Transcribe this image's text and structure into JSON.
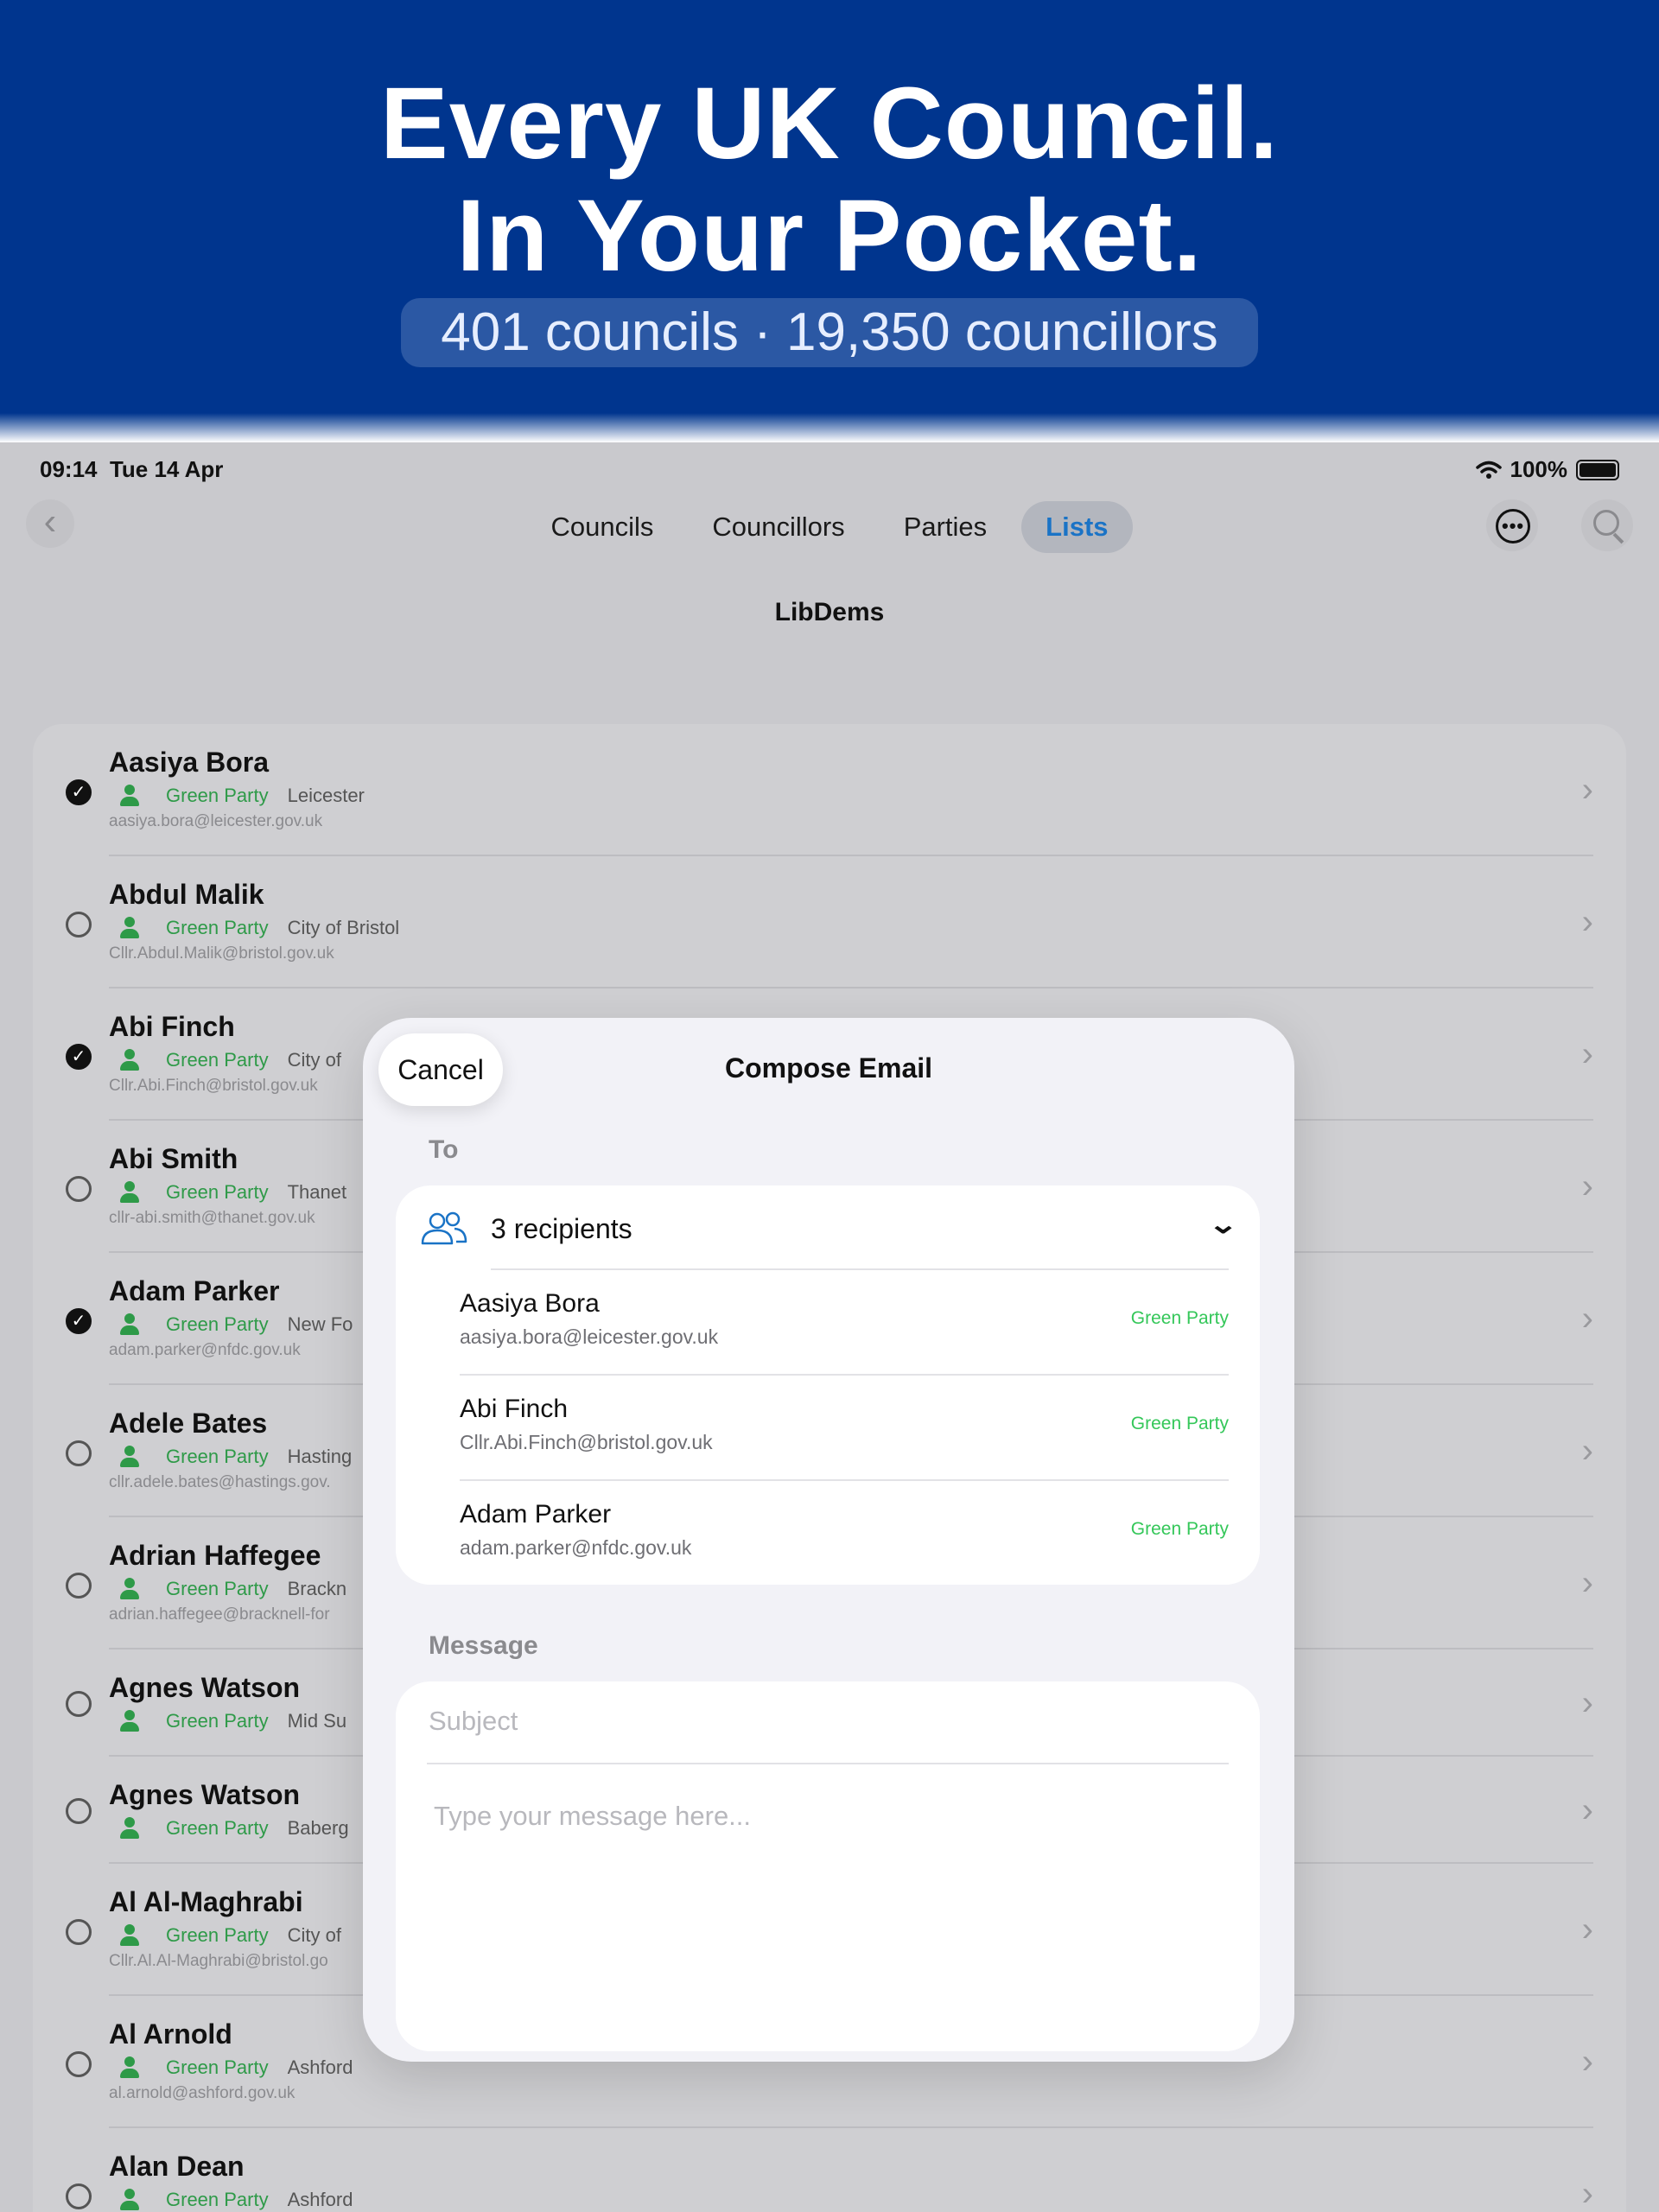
{
  "banner": {
    "headline_line1": "Every UK Council.",
    "headline_line2": "In Your Pocket.",
    "stats": "401 councils · 19,350 councillors",
    "background_color": "#00358e"
  },
  "status_bar": {
    "time": "09:14",
    "date": "Tue 14 Apr",
    "battery": "100%"
  },
  "nav": {
    "tabs": [
      {
        "label": "Councils",
        "active": false
      },
      {
        "label": "Councillors",
        "active": false
      },
      {
        "label": "Parties",
        "active": false
      },
      {
        "label": "Lists",
        "active": true
      }
    ],
    "accent_color": "#1a73c6"
  },
  "list": {
    "title": "LibDems",
    "rows": [
      {
        "name": "Aasiya Bora",
        "party": "Green Party",
        "council": "Leicester",
        "email": "aasiya.bora@leicester.gov.uk",
        "checked": true
      },
      {
        "name": "Abdul Malik",
        "party": "Green Party",
        "council": "City of Bristol",
        "email": "Cllr.Abdul.Malik@bristol.gov.uk",
        "checked": false
      },
      {
        "name": "Abi Finch",
        "party": "Green Party",
        "council": "City of",
        "email": "Cllr.Abi.Finch@bristol.gov.uk",
        "checked": true
      },
      {
        "name": "Abi Smith",
        "party": "Green Party",
        "council": "Thanet",
        "email": "cllr-abi.smith@thanet.gov.uk",
        "checked": false
      },
      {
        "name": "Adam Parker",
        "party": "Green Party",
        "council": "New Fo",
        "email": "adam.parker@nfdc.gov.uk",
        "checked": true
      },
      {
        "name": "Adele Bates",
        "party": "Green Party",
        "council": "Hasting",
        "email": "cllr.adele.bates@hastings.gov.",
        "checked": false
      },
      {
        "name": "Adrian Haffegee",
        "party": "Green Party",
        "council": "Brackn",
        "email": "adrian.haffegee@bracknell-for",
        "checked": false
      },
      {
        "name": "Agnes Watson",
        "party": "Green Party",
        "council": "Mid Su",
        "email": "",
        "checked": false
      },
      {
        "name": "Agnes Watson",
        "party": "Green Party",
        "council": "Baberg",
        "email": "",
        "checked": false
      },
      {
        "name": "Al Al-Maghrabi",
        "party": "Green Party",
        "council": "City of",
        "email": "Cllr.Al.Al-Maghrabi@bristol.go",
        "checked": false
      },
      {
        "name": "Al Arnold",
        "party": "Green Party",
        "council": "Ashford",
        "email": "al.arnold@ashford.gov.uk",
        "checked": false
      },
      {
        "name": "Alan Dean",
        "party": "Green Party",
        "council": "Ashford",
        "email": "",
        "checked": false
      }
    ]
  },
  "compose": {
    "cancel_label": "Cancel",
    "title": "Compose Email",
    "to_label": "To",
    "recipients_summary": "3 recipients",
    "recipients": [
      {
        "name": "Aasiya Bora",
        "email": "aasiya.bora@leicester.gov.uk",
        "party": "Green Party"
      },
      {
        "name": "Abi Finch",
        "email": "Cllr.Abi.Finch@bristol.gov.uk",
        "party": "Green Party"
      },
      {
        "name": "Adam Parker",
        "email": "adam.parker@nfdc.gov.uk",
        "party": "Green Party"
      }
    ],
    "message_label": "Message",
    "subject_placeholder": "Subject",
    "body_placeholder": "Type your message here..."
  },
  "icons": {
    "back": "chevron-left-icon",
    "more": "ellipsis-circle-icon",
    "search": "magnifier-icon",
    "wifi": "wifi-icon",
    "battery": "battery-icon",
    "person": "person-icon",
    "group": "group-icon",
    "row_chevron": "chevron-right-icon",
    "expand": "chevron-down-icon"
  },
  "colors": {
    "party_green": "#2e9a48",
    "party_label_light": "#34c759"
  }
}
